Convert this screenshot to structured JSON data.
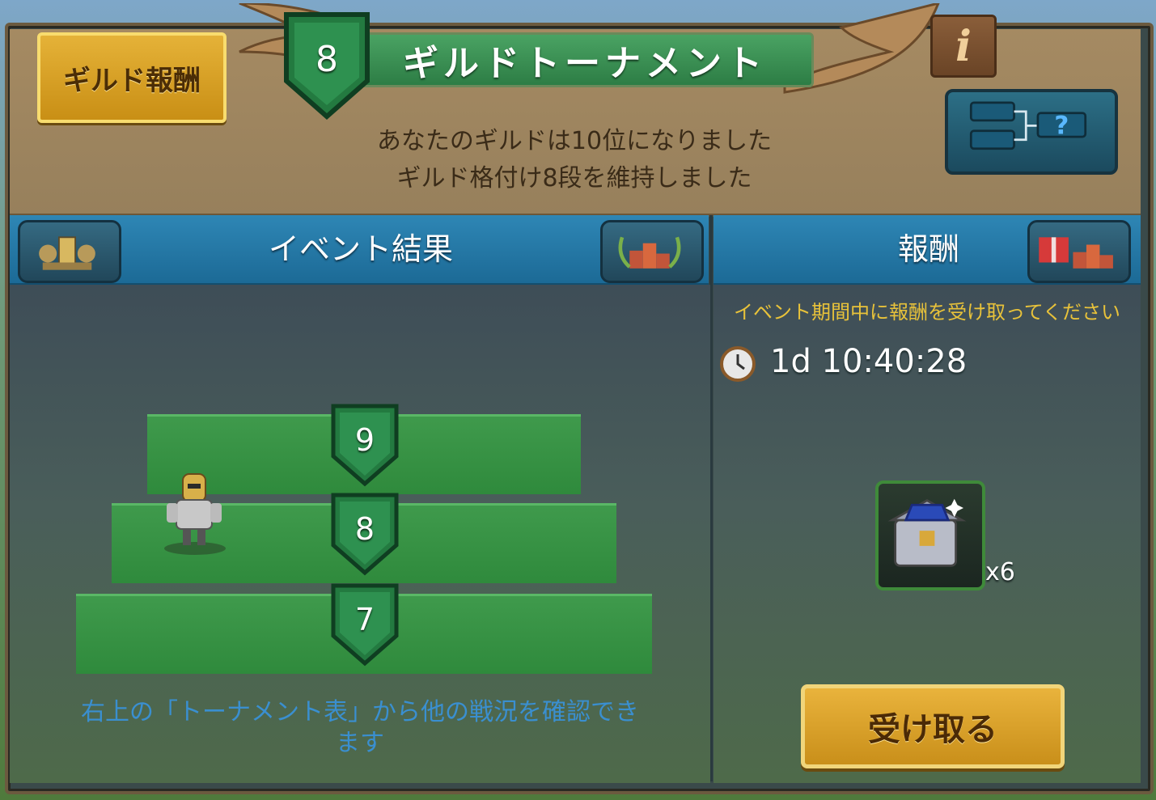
{
  "header": {
    "reward_button_label": "ギルド報酬",
    "rank": "8",
    "title": "ギルドトーナメント",
    "info_label": "i",
    "summary_line1": "あなたのギルドは10位になりました",
    "summary_line2": "ギルド格付け8段を維持しました"
  },
  "left_panel": {
    "title": "イベント結果",
    "steps": [
      {
        "rank": "9"
      },
      {
        "rank": "8"
      },
      {
        "rank": "7"
      }
    ],
    "hint_line1": "右上の「トーナメント表」から他の戦況を確認でき",
    "hint_line2": "ます"
  },
  "right_panel": {
    "title": "報酬",
    "notice": "イベント期間中に報酬を受け取ってください",
    "timer": "1d 10:40:28",
    "item_qty": "x6",
    "claim_label": "受け取る"
  },
  "colors": {
    "accent_gold": "#e5b238",
    "header_tan": "#a58a62",
    "panel_blue": "#2e86b5",
    "step_green": "#3f9a4c",
    "hint_blue": "#3a8fd0",
    "notice_yellow": "#e8c23a"
  }
}
